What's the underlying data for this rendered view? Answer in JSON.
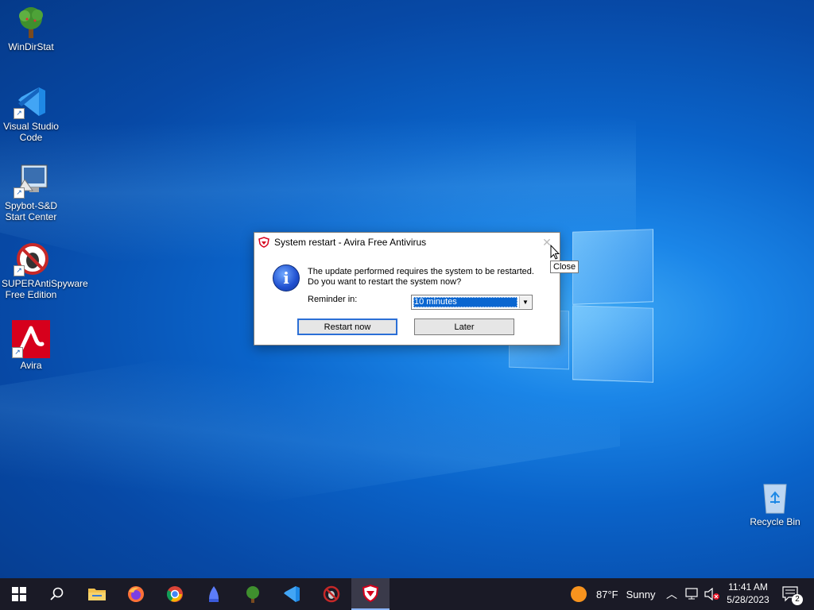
{
  "desktop": {
    "icons": [
      {
        "label": "WinDirStat",
        "icon": "windirstat-icon"
      },
      {
        "label": "Visual Studio Code",
        "icon": "vscode-icon"
      },
      {
        "label": "Spybot-S&D Start Center",
        "icon": "spybot-icon"
      },
      {
        "label": "SUPERAntiSpyware Free Edition",
        "icon": "superantispyware-icon"
      },
      {
        "label": "Avira",
        "icon": "avira-icon"
      }
    ],
    "recycle_bin": {
      "label": "Recycle Bin"
    }
  },
  "dialog": {
    "title": "System restart - Avira Free Antivirus",
    "message_line1": "The update performed requires the system to be restarted.",
    "message_line2": "Do you want to restart the system now?",
    "reminder_label": "Reminder in:",
    "reminder_value": "10 minutes",
    "restart_button": "Restart now",
    "later_button": "Later",
    "close_tooltip": "Close"
  },
  "taskbar": {
    "apps": [
      "start-icon",
      "search-icon",
      "file-explorer-icon",
      "firefox-icon",
      "chrome-icon",
      "spybot-icon",
      "windirstat-icon",
      "vscode-icon",
      "superantispyware-icon",
      "avira-icon"
    ],
    "weather_temp": "87°F",
    "weather_desc": "Sunny",
    "time": "11:41 AM",
    "date": "5/28/2023",
    "notifications_count": "2"
  },
  "colors": {
    "accent": "#0a66d0",
    "avira_red": "#d6001c"
  }
}
